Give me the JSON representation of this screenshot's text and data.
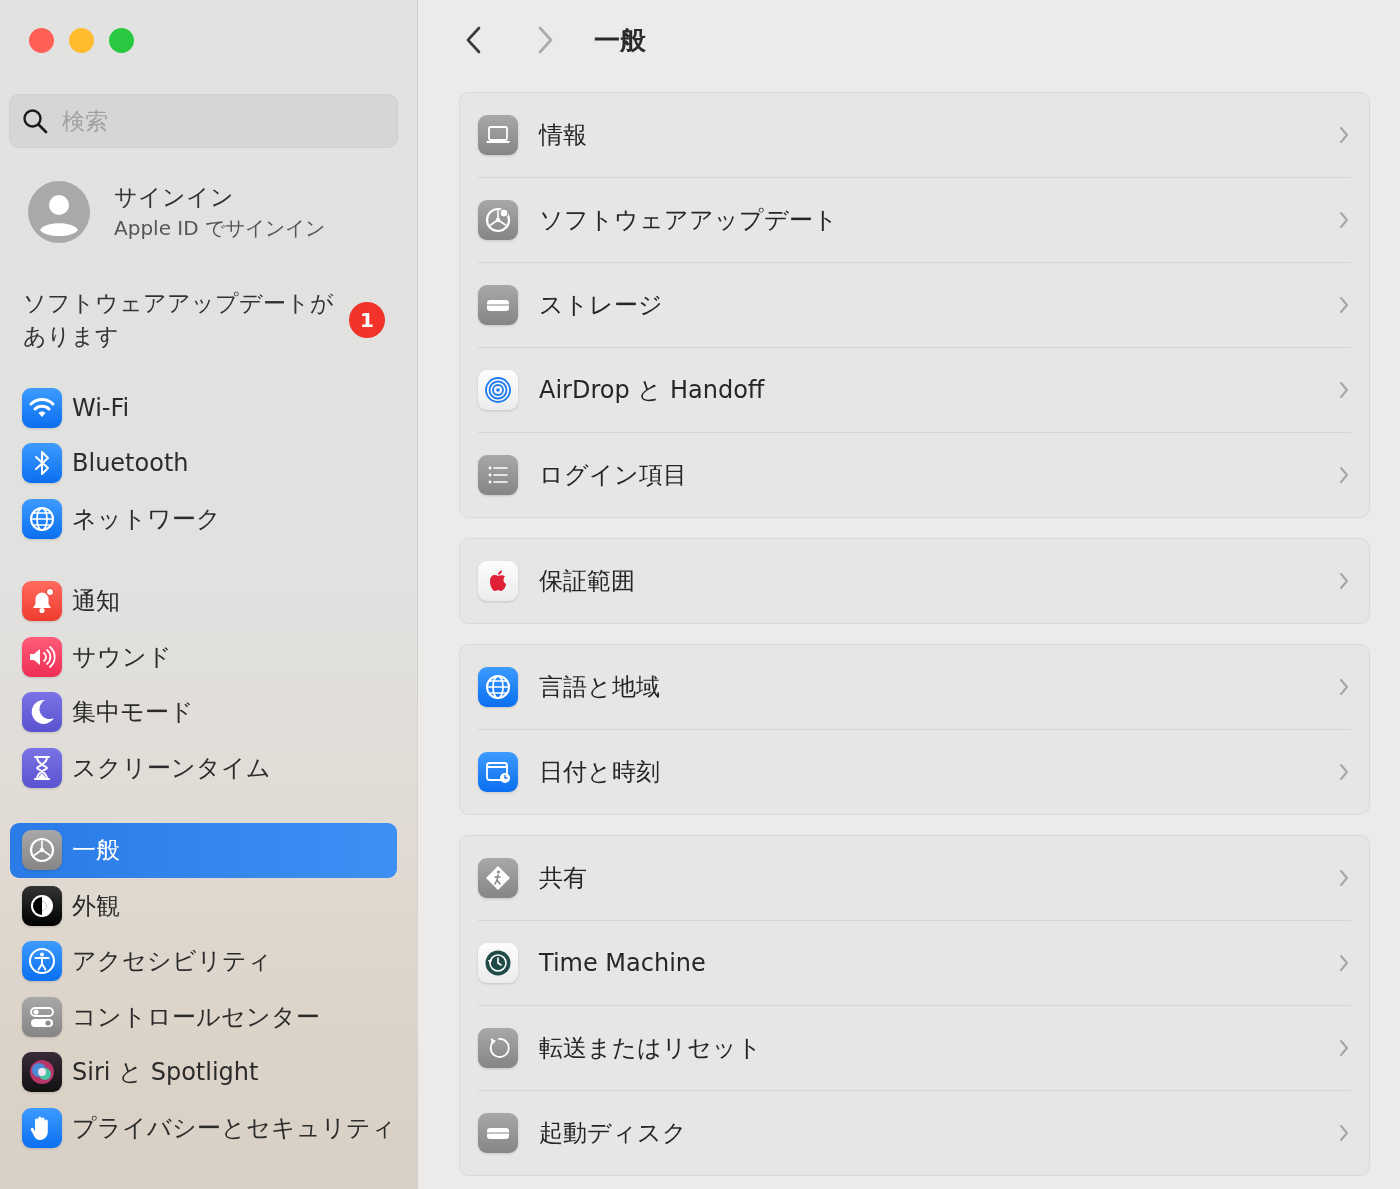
{
  "window": {
    "title": "一般",
    "back": {
      "disabled": false
    },
    "forward": {
      "disabled": true
    }
  },
  "search": {
    "placeholder": "検索"
  },
  "account": {
    "title": "サインイン",
    "subtitle": "Apple ID でサインイン"
  },
  "update_notice": {
    "text": "ソフトウェアアップデートがあります",
    "badge": "1"
  },
  "sidebar": {
    "groups": [
      {
        "items": [
          {
            "kind": "wifi",
            "label": "Wi-Fi",
            "selected": false
          },
          {
            "kind": "bluetooth",
            "label": "Bluetooth",
            "selected": false
          },
          {
            "kind": "network",
            "label": "ネットワーク",
            "selected": false
          }
        ]
      },
      {
        "items": [
          {
            "kind": "notifications",
            "label": "通知",
            "selected": false
          },
          {
            "kind": "sound",
            "label": "サウンド",
            "selected": false
          },
          {
            "kind": "focus",
            "label": "集中モード",
            "selected": false
          },
          {
            "kind": "screentime",
            "label": "スクリーンタイム",
            "selected": false
          }
        ]
      },
      {
        "items": [
          {
            "kind": "general",
            "label": "一般",
            "selected": true
          },
          {
            "kind": "appearance",
            "label": "外観",
            "selected": false
          },
          {
            "kind": "accessibility",
            "label": "アクセシビリティ",
            "selected": false
          },
          {
            "kind": "control",
            "label": "コントロールセンター",
            "selected": false
          },
          {
            "kind": "siri",
            "label": "Siri と Spotlight",
            "selected": false
          },
          {
            "kind": "privacy",
            "label": "プライバシーとセキュリティ",
            "selected": false
          }
        ]
      }
    ]
  },
  "main": {
    "groups": [
      {
        "rows": [
          {
            "kind": "about",
            "label": "情報"
          },
          {
            "kind": "update",
            "label": "ソフトウェアアップデート"
          },
          {
            "kind": "storage",
            "label": "ストレージ"
          },
          {
            "kind": "airdrop",
            "label": "AirDrop と Handoff"
          },
          {
            "kind": "login",
            "label": "ログイン項目"
          }
        ]
      },
      {
        "rows": [
          {
            "kind": "warranty",
            "label": "保証範囲"
          }
        ]
      },
      {
        "rows": [
          {
            "kind": "language",
            "label": "言語と地域"
          },
          {
            "kind": "datetime",
            "label": "日付と時刻"
          }
        ]
      },
      {
        "rows": [
          {
            "kind": "sharing",
            "label": "共有"
          },
          {
            "kind": "timemachine",
            "label": "Time Machine"
          },
          {
            "kind": "reset",
            "label": "転送またはリセット"
          },
          {
            "kind": "startup",
            "label": "起動ディスク"
          }
        ]
      }
    ]
  }
}
